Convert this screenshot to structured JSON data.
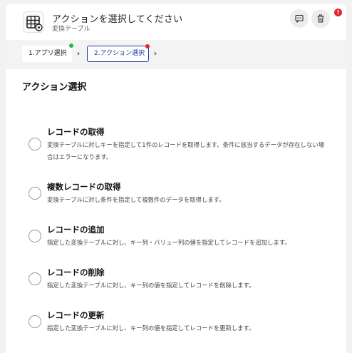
{
  "header": {
    "title": "アクションを選択してください",
    "subtitle": "変換テーブル",
    "app_icon": "table-gear-icon",
    "buttons": [
      {
        "icon": "message-icon"
      },
      {
        "icon": "trash-icon"
      }
    ],
    "alert_badge": "!",
    "alert_color": "#e0252b"
  },
  "steps": [
    {
      "label": "1.アプリ選択",
      "status": "complete",
      "status_color": "#2bb54a"
    },
    {
      "label": "2.アクション選択",
      "status": "error",
      "status_color": "#e0252b",
      "active": true
    }
  ],
  "accent_color": "#1d3ba3",
  "main": {
    "section_title": "アクション選択",
    "options": [
      {
        "title": "レコードの取得",
        "description": "変換テーブルに対しキーを指定して1件のレコードを取得します。条件に該当するデータが存在しない場合はエラーになります。"
      },
      {
        "title": "複数レコードの取得",
        "description": "変換テーブルに対し条件を指定して複数件のデータを取得します。"
      },
      {
        "title": "レコードの追加",
        "description": "指定した変換テーブルに対し、キー列・バリュー列の値を指定してレコードを追加します。"
      },
      {
        "title": "レコードの削除",
        "description": "指定した変換テーブルに対し、キー列の値を指定してレコードを削除します。"
      },
      {
        "title": "レコードの更新",
        "description": "指定した変換テーブルに対し、キー列の値を指定してレコードを更新します。"
      }
    ]
  }
}
